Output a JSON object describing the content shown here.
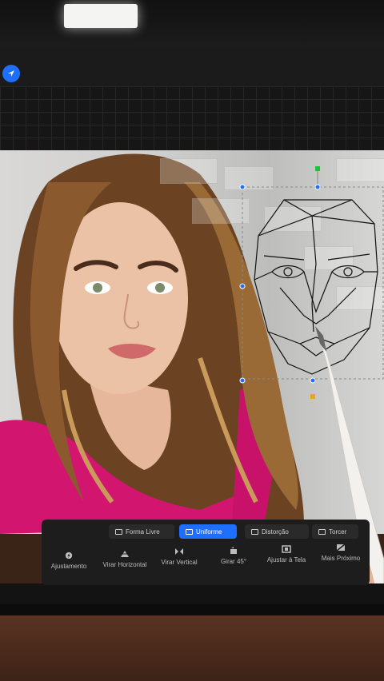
{
  "transform_modes": [
    {
      "label": "Forma Livre",
      "active": false
    },
    {
      "label": "Uniforme",
      "active": true
    },
    {
      "label": "Distorção",
      "active": false
    },
    {
      "label": "Torcer",
      "active": false
    }
  ],
  "transform_actions": [
    {
      "label": "Ajustamento",
      "icon": "magnet-icon"
    },
    {
      "label": "Virar Horizontal",
      "icon": "flip-horizontal-icon"
    },
    {
      "label": "Virar Vertical",
      "icon": "flip-vertical-icon"
    },
    {
      "label": "Girar 45°",
      "icon": "rotate-icon"
    },
    {
      "label": "Ajustar à Tela",
      "icon": "fit-to-screen-icon"
    },
    {
      "label": "Mais Próximo",
      "icon": "interpolation-icon"
    }
  ],
  "colors": {
    "accent": "#1f6fff",
    "selection_handle_green": "#22c03a",
    "pivot_orange": "#f0a020"
  }
}
